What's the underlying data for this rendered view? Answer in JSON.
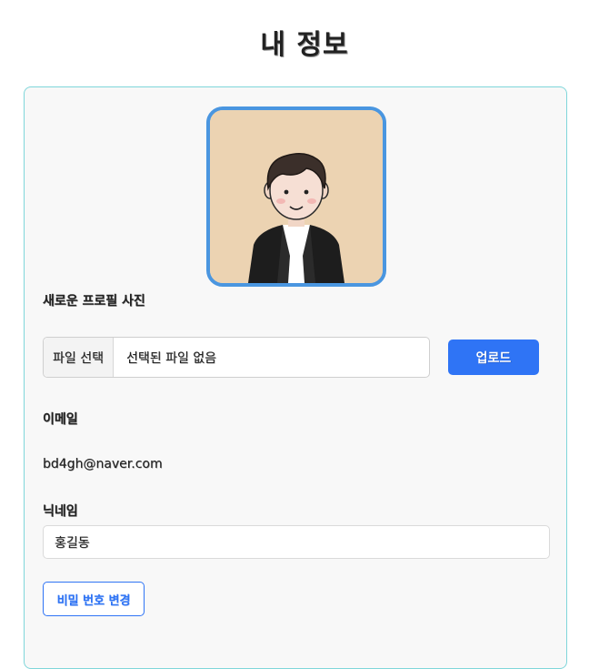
{
  "page": {
    "title": "내 정보"
  },
  "profile": {
    "photo_label": "새로운 프로필 사진",
    "file_select_label": "파일 선택",
    "file_name_placeholder": "선택된 파일 없음",
    "upload_label": "업로드"
  },
  "email": {
    "label": "이메일",
    "value": "bd4gh@naver.com"
  },
  "nickname": {
    "label": "닉네임",
    "value": "홍길동"
  },
  "actions": {
    "change_password_label": "비밀 번호 변경"
  },
  "colors": {
    "accent": "#2f74f5",
    "avatar_border": "#4a96e0",
    "card_border": "#7fd6da",
    "avatar_bg": "#ecd3b2"
  }
}
